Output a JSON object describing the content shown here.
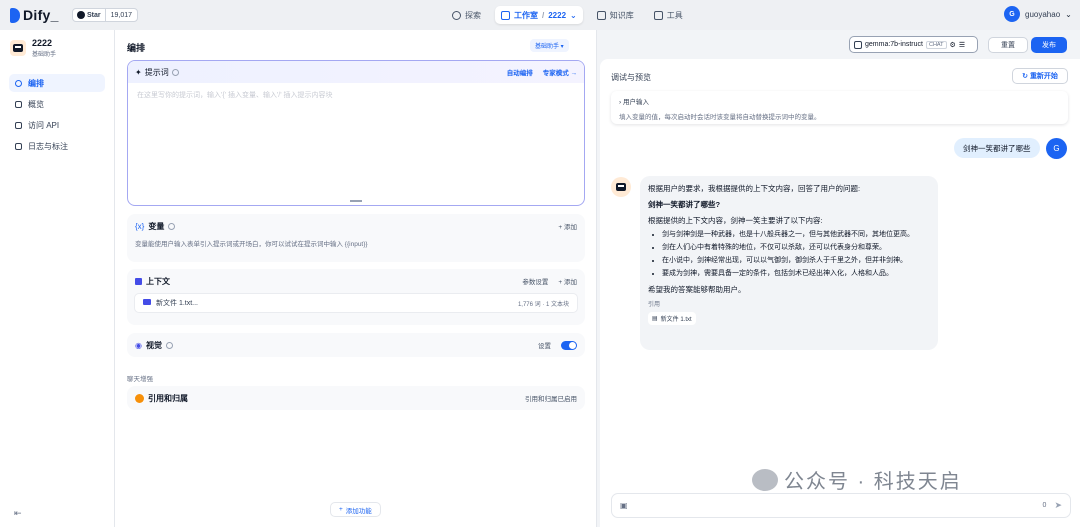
{
  "header": {
    "logo_text": "Dify_",
    "star_label": "Star",
    "star_count": "19,017",
    "nav": {
      "explore": "探索",
      "studio": "工作室",
      "studio_app": "2222",
      "knowledge": "知识库",
      "tools": "工具"
    },
    "user": {
      "initial": "G",
      "name": "guoyahao"
    }
  },
  "sidebar": {
    "app_name": "2222",
    "app_type": "基础助手",
    "items": [
      {
        "label": "编排"
      },
      {
        "label": "概览"
      },
      {
        "label": "访问 API"
      },
      {
        "label": "日志与标注"
      }
    ]
  },
  "orchestrate": {
    "title": "编排",
    "mode_badge": "基础助手 ▾",
    "prompt": {
      "label": "提示词",
      "auto_label": "自动编排",
      "expert_label": "专家模式 →",
      "placeholder": "在这里写你的提示词，输入'{' 插入变量、输入'/' 插入提示内容块"
    },
    "variables": {
      "label": "变量",
      "add": "+ 添加",
      "desc": "变量能使用户输入表单引入提示词或开场白，你可以试试在提示词中输入 {{input}}"
    },
    "context": {
      "label": "上下文",
      "settings": "参数设置",
      "add": "+ 添加",
      "file_name": "新文件 1.txt...",
      "file_meta": "1,776 词 · 1 文本块"
    },
    "vision": {
      "label": "视觉",
      "settings": "设置"
    },
    "section_label": "聊天增强",
    "citation": {
      "label": "引用和归属",
      "status": "引用和归属已启用"
    },
    "add_feature": "添加功能"
  },
  "toolbar": {
    "model": "gemma:7b-instruct",
    "model_tag": "CHAT",
    "reset": "重置",
    "publish": "发布"
  },
  "debug": {
    "title": "调试与预览",
    "restart": "重新开始",
    "inputs_title": "用户输入",
    "inputs_desc": "填入变量的值，每次启动时会话时该变量将自动替换提示词中的变量。",
    "question": "剑神一笑都讲了哪些",
    "user_initial": "G",
    "answer": {
      "intro": "根据用户的要求，我根据提供的上下文内容，回答了用户的问题:",
      "heading": "剑神一笑都讲了哪些?",
      "lead": "根据提供的上下文内容，剑神一笑主要讲了以下内容:",
      "bullets": [
        "剑与剑神剑是一种武器，也是十八般兵器之一，但与其他武器不同，其地位更高。",
        "剑在人们心中有着特殊的地位，不仅可以杀敌，还可以代表身分和尊荣。",
        "在小说中，剑神经常出现，可以以气御剑，御剑杀人于千里之外，但并非剑神。",
        "要成为剑神，需要具备一定的条件，包括剑术已经出神入化，人格和人品。"
      ],
      "closing": "希望我的答案能够帮助用户。",
      "cite_label": "引用",
      "cite_file": "新文件 1.txt"
    },
    "chat_counter": "0"
  },
  "watermark": "公众号 · 科技天启"
}
